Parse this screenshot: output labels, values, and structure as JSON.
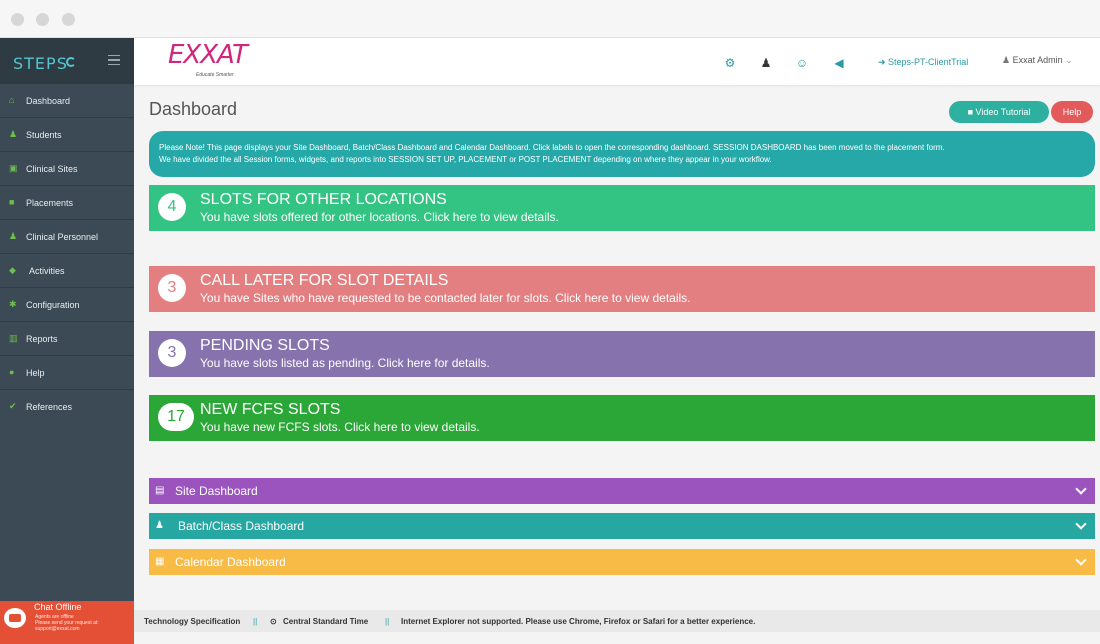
{
  "sidebar": {
    "logo": "STEPS",
    "items": [
      {
        "label": "Dashboard",
        "icon": "dashboard-icon"
      },
      {
        "label": "Students",
        "icon": "students-icon"
      },
      {
        "label": "Clinical Sites",
        "icon": "clinical-sites-icon"
      },
      {
        "label": "Placements",
        "icon": "placements-icon"
      },
      {
        "label": "Clinical Personnel",
        "icon": "clinical-personnel-icon"
      },
      {
        "label": "Activities",
        "icon": "activities-icon"
      },
      {
        "label": "Configuration",
        "icon": "configuration-icon"
      },
      {
        "label": "Reports",
        "icon": "reports-icon"
      },
      {
        "label": "Help",
        "icon": "help-icon"
      },
      {
        "label": "References",
        "icon": "references-icon"
      }
    ],
    "chat": {
      "title": "Chat Offline",
      "line1": "Agents are offline",
      "line2": "Please send your request at:",
      "email": "support@exxat.com"
    }
  },
  "header": {
    "logo_text": "EXXAT",
    "logo_tagline": "Educate Smarter",
    "client_link": "Steps-PT-ClientTrial",
    "user": "Exxat Admin"
  },
  "page": {
    "title": "Dashboard",
    "video_tutorial": "Video Tutorial",
    "help": "Help",
    "note_line1": "Please Note! This page displays your Site Dashboard, Batch/Class Dashboard and Calendar Dashboard. Click labels to open the corresponding dashboard. SESSION DASHBOARD has been moved to the placement form.",
    "note_line2": "We have divided the all Session forms, widgets, and reports into SESSION SET UP, PLACEMENT or POST PLACEMENT depending on where they appear in your workflow."
  },
  "cards": [
    {
      "count": "4",
      "title": "SLOTS FOR OTHER LOCATIONS",
      "subtitle": "You have slots offered for other locations. Click here to view details.",
      "color": "#33c483"
    },
    {
      "count": "3",
      "title": "CALL LATER FOR SLOT DETAILS",
      "subtitle": "You have Sites who have requested to be contacted later for slots. Click here to view details.",
      "color": "#e37f80"
    },
    {
      "count": "3",
      "title": "PENDING SLOTS",
      "subtitle": "You have slots listed as pending. Click here for details.",
      "color": "#8673ae"
    },
    {
      "count": "17",
      "title": "NEW FCFS SLOTS",
      "subtitle": "You have new FCFS slots. Click here to view details.",
      "color": "#2ba737"
    }
  ],
  "accordions": [
    {
      "label": "Site Dashboard",
      "color": "#9b54bd"
    },
    {
      "label": "Batch/Class Dashboard",
      "color": "#27a7a1"
    },
    {
      "label": "Calendar Dashboard",
      "color": "#f8bb45"
    }
  ],
  "footer": {
    "tech_spec": "Technology Specification",
    "separator": "||",
    "timezone": "Central Standard Time",
    "browser_note": "Internet Explorer not supported. Please use Chrome, Firefox or Safari for a better experience."
  }
}
